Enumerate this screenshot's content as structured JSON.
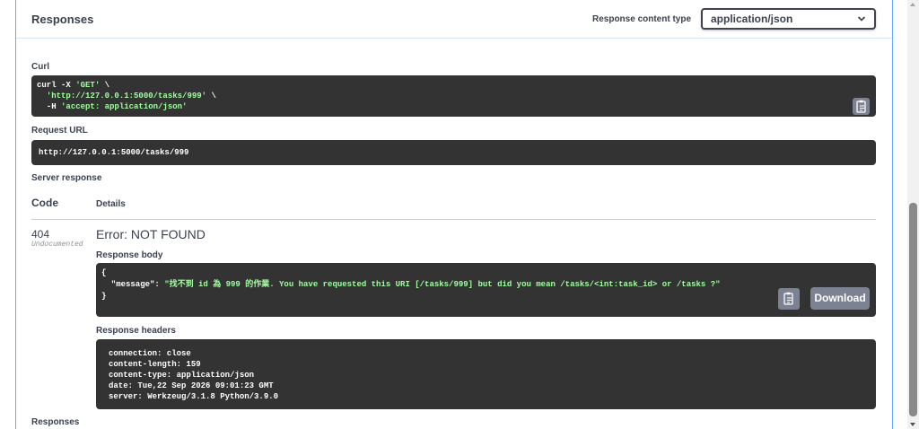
{
  "responses_header": {
    "title": "Responses",
    "content_type_label": "Response content type",
    "content_type_value": "application/json"
  },
  "curl": {
    "label": "Curl",
    "lines": [
      [
        {
          "t": "curl -X ",
          "c": "w"
        },
        {
          "t": "'GET'",
          "c": "g"
        },
        {
          "t": " \\",
          "c": "w"
        }
      ],
      [
        {
          "t": "  ",
          "c": "w"
        },
        {
          "t": "'http://127.0.0.1:5000/tasks/999'",
          "c": "g"
        },
        {
          "t": " \\",
          "c": "w"
        }
      ],
      [
        {
          "t": "  -H ",
          "c": "w"
        },
        {
          "t": "'accept: application/json'",
          "c": "g"
        }
      ]
    ]
  },
  "request_url": {
    "label": "Request URL",
    "value": "http://127.0.0.1:5000/tasks/999"
  },
  "server_response": {
    "label": "Server response",
    "code_header": "Code",
    "details_header": "Details",
    "status_code": "404",
    "status_note": "Undocumented",
    "error_title": "Error: NOT FOUND",
    "body_label": "Response body",
    "body_lines": [
      [
        {
          "t": "{",
          "c": "w"
        }
      ],
      [
        {
          "t": "  \"message\": ",
          "c": "w"
        },
        {
          "t": "\"找不到 id 為 999 的作業. You have requested this URI [/tasks/999] but did you mean /tasks/<int:task_id> or /tasks ?\"",
          "c": "g"
        }
      ],
      [
        {
          "t": "}",
          "c": "w"
        }
      ]
    ],
    "download_label": "Download",
    "headers_label": "Response headers",
    "header_lines": [
      "connection: close",
      "content-length: 159",
      "content-type: application/json",
      "date: Tue,22 Sep 2026 09:01:23 GMT",
      "server: Werkzeug/3.1.8 Python/3.9.0"
    ]
  },
  "footer": {
    "responses_label": "Responses"
  },
  "icons": {
    "copy": "clipboard-icon",
    "chevron": "chevron-down-icon"
  }
}
